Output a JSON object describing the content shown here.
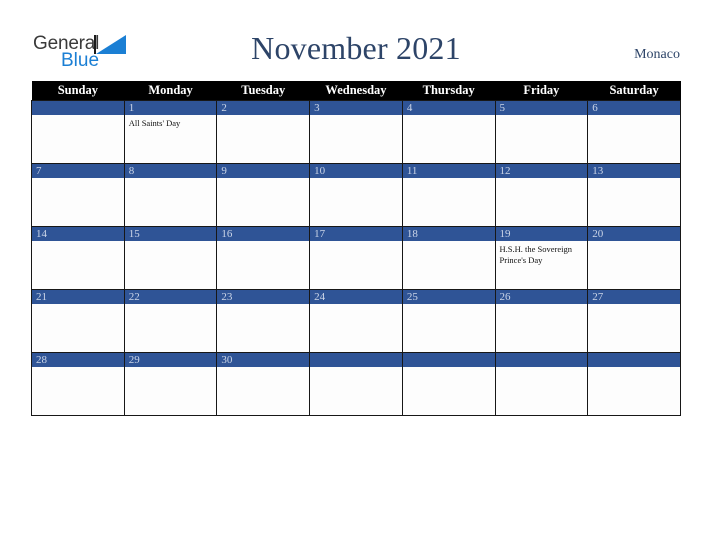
{
  "brand": {
    "name_part1": "General",
    "name_part2": "Blue",
    "triangle_color": "#1b7fd4"
  },
  "header": {
    "title": "November 2021",
    "location": "Monaco",
    "title_color": "#2d4468"
  },
  "calendar": {
    "weekday_headers": [
      "Sunday",
      "Monday",
      "Tuesday",
      "Wednesday",
      "Thursday",
      "Friday",
      "Saturday"
    ],
    "header_bg": "#000000",
    "daybar_bg": "#2f5496",
    "weeks": [
      [
        {
          "date": "",
          "events": []
        },
        {
          "date": "1",
          "events": [
            "All Saints' Day"
          ]
        },
        {
          "date": "2",
          "events": []
        },
        {
          "date": "3",
          "events": []
        },
        {
          "date": "4",
          "events": []
        },
        {
          "date": "5",
          "events": []
        },
        {
          "date": "6",
          "events": []
        }
      ],
      [
        {
          "date": "7",
          "events": []
        },
        {
          "date": "8",
          "events": []
        },
        {
          "date": "9",
          "events": []
        },
        {
          "date": "10",
          "events": []
        },
        {
          "date": "11",
          "events": []
        },
        {
          "date": "12",
          "events": []
        },
        {
          "date": "13",
          "events": []
        }
      ],
      [
        {
          "date": "14",
          "events": []
        },
        {
          "date": "15",
          "events": []
        },
        {
          "date": "16",
          "events": []
        },
        {
          "date": "17",
          "events": []
        },
        {
          "date": "18",
          "events": []
        },
        {
          "date": "19",
          "events": [
            "H.S.H. the Sovereign Prince's Day"
          ]
        },
        {
          "date": "20",
          "events": []
        }
      ],
      [
        {
          "date": "21",
          "events": []
        },
        {
          "date": "22",
          "events": []
        },
        {
          "date": "23",
          "events": []
        },
        {
          "date": "24",
          "events": []
        },
        {
          "date": "25",
          "events": []
        },
        {
          "date": "26",
          "events": []
        },
        {
          "date": "27",
          "events": []
        }
      ],
      [
        {
          "date": "28",
          "events": []
        },
        {
          "date": "29",
          "events": []
        },
        {
          "date": "30",
          "events": []
        },
        {
          "date": "",
          "events": []
        },
        {
          "date": "",
          "events": []
        },
        {
          "date": "",
          "events": []
        },
        {
          "date": "",
          "events": []
        }
      ]
    ]
  }
}
